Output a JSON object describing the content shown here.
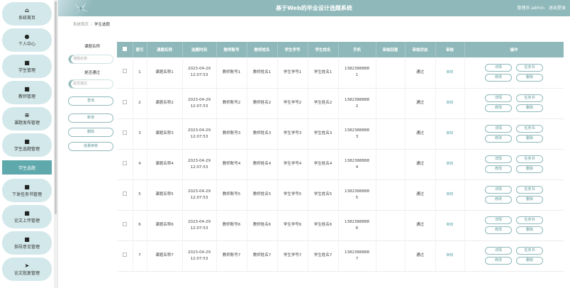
{
  "sidebar": {
    "items": [
      {
        "icon": "⌂",
        "label": "系统首页"
      },
      {
        "icon": "●",
        "label": "个人中心"
      },
      {
        "icon": "■",
        "label": "学生管理"
      },
      {
        "icon": "■",
        "label": "教师管理"
      },
      {
        "icon": "≡",
        "label": "课题发布管理"
      },
      {
        "icon": "■",
        "label": "学生选题管理"
      },
      {
        "icon": "■",
        "label": "下发任务书管理"
      },
      {
        "icon": "■",
        "label": "论文上传管理"
      },
      {
        "icon": "■",
        "label": "指导意见管理"
      },
      {
        "icon": "➤",
        "label": "论文批复管理"
      }
    ],
    "sub_item": "学生选题"
  },
  "header": {
    "title": "基于Web的毕业设计选题系统",
    "admin_text": "管理员 admin",
    "logout": "退出登录"
  },
  "breadcrumb": {
    "home": "系统首页",
    "sep": "/",
    "current": "学生选题"
  },
  "search": {
    "topic_label": "课题名称",
    "topic_placeholder": "课题名称",
    "approved_label": "是否通过",
    "approved_placeholder": "是否通过",
    "query_btn": "查询",
    "add_btn": "新增",
    "delete_btn": "删除",
    "batch_audit_btn": "批量审核"
  },
  "table": {
    "headers": [
      "",
      "索引",
      "课题名称",
      "选题时间",
      "教师账号",
      "教师姓名",
      "学生学号",
      "学生姓名",
      "手机",
      "审核回复",
      "审核状态",
      "审核",
      "操作"
    ],
    "rows": [
      {
        "idx": "1",
        "topic": "课题名称1",
        "date": "2023-04-29",
        "time": "12:07:53",
        "tacc": "教师账号1",
        "tname": "教师姓名1",
        "sid": "学生学号1",
        "sname": "学生姓名1",
        "phone_a": "1382388888",
        "phone_b": "1",
        "reply": "",
        "status": "通过",
        "audit": "审核"
      },
      {
        "idx": "2",
        "topic": "课题名称2",
        "date": "2023-04-29",
        "time": "12:07:53",
        "tacc": "教师账号2",
        "tname": "教师姓名2",
        "sid": "学生学号2",
        "sname": "学生姓名2",
        "phone_a": "1382388888",
        "phone_b": "2",
        "reply": "",
        "status": "通过",
        "audit": "审核"
      },
      {
        "idx": "3",
        "topic": "课题名称3",
        "date": "2023-04-29",
        "time": "12:07:53",
        "tacc": "教师账号3",
        "tname": "教师姓名3",
        "sid": "学生学号3",
        "sname": "学生姓名3",
        "phone_a": "1382388888",
        "phone_b": "3",
        "reply": "",
        "status": "通过",
        "audit": "审核"
      },
      {
        "idx": "4",
        "topic": "课题名称4",
        "date": "2023-04-29",
        "time": "12:07:53",
        "tacc": "教师账号4",
        "tname": "教师姓名4",
        "sid": "学生学号4",
        "sname": "学生姓名4",
        "phone_a": "1382388888",
        "phone_b": "4",
        "reply": "",
        "status": "通过",
        "audit": "审核"
      },
      {
        "idx": "5",
        "topic": "课题名称5",
        "date": "2023-04-29",
        "time": "12:07:53",
        "tacc": "教师账号5",
        "tname": "教师姓名5",
        "sid": "学生学号5",
        "sname": "学生姓名5",
        "phone_a": "1382388888",
        "phone_b": "5",
        "reply": "",
        "status": "通过",
        "audit": "审核"
      },
      {
        "idx": "6",
        "topic": "课题名称6",
        "date": "2023-04-29",
        "time": "12:07:53",
        "tacc": "教师账号6",
        "tname": "教师姓名6",
        "sid": "学生学号6",
        "sname": "学生姓名6",
        "phone_a": "1382388888",
        "phone_b": "6",
        "reply": "",
        "status": "通过",
        "audit": "审核"
      },
      {
        "idx": "7",
        "topic": "课题名称7",
        "date": "2023-04-29",
        "time": "12:07:53",
        "tacc": "教师账号7",
        "tname": "教师姓名7",
        "sid": "学生学号7",
        "sname": "学生姓名7",
        "phone_a": "1382388888",
        "phone_b": "7",
        "reply": "",
        "status": "通过",
        "audit": "审核"
      }
    ],
    "op_labels": {
      "detail": "详情",
      "task": "任务书",
      "edit": "修改",
      "delete": "删除"
    }
  }
}
